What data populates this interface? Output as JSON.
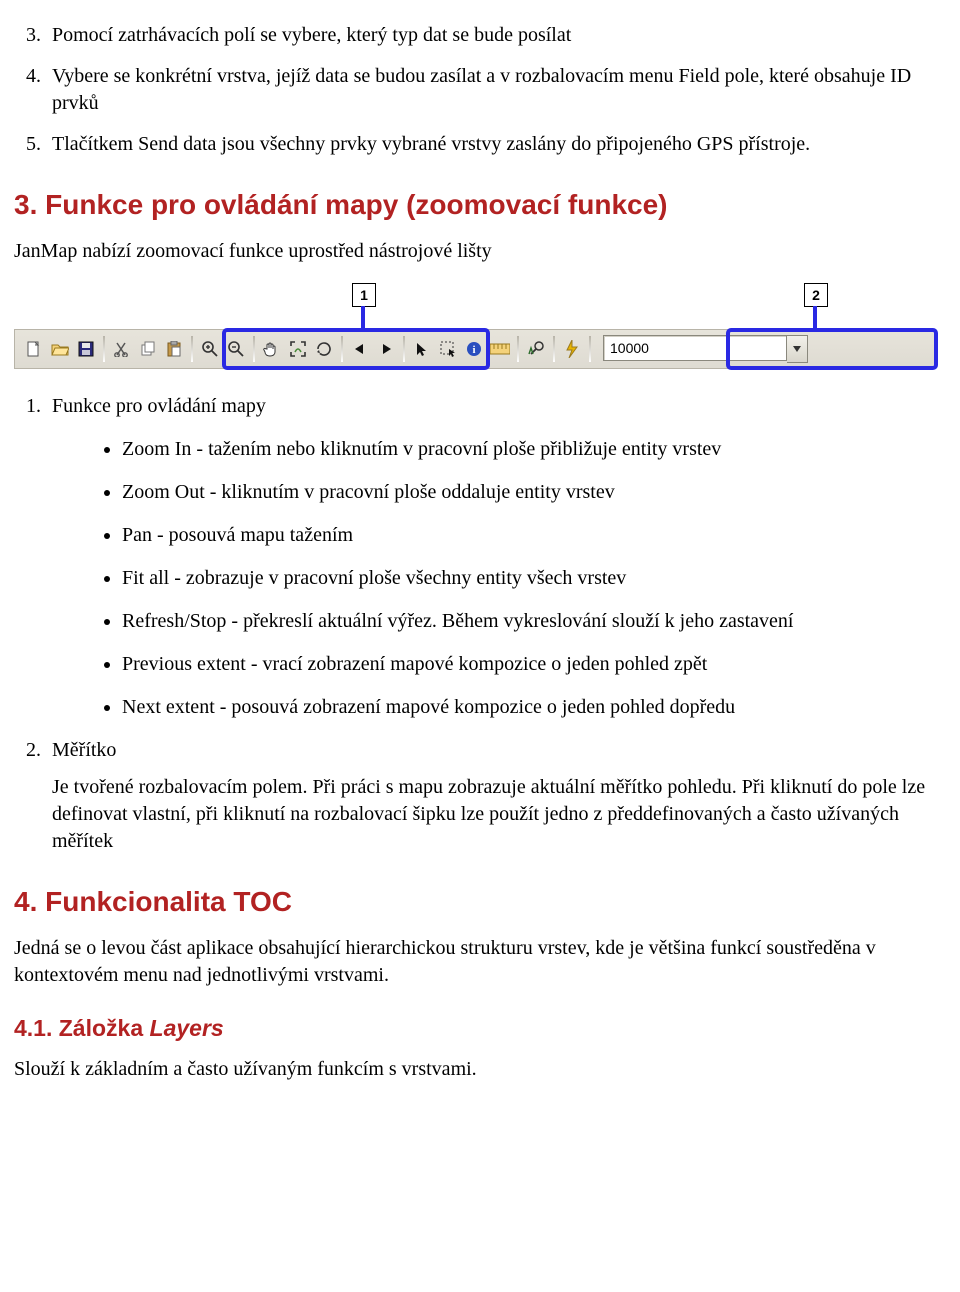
{
  "intro_list": {
    "start": 3,
    "items": [
      "Pomocí zatrhávacích polí se vybere, který typ dat se bude posílat",
      "Vybere se konkrétní vrstva, jejíž data se budou zasílat a v rozbalovacím menu Field pole, které obsahuje ID prvků",
      "Tlačítkem Send data jsou všechny prvky vybrané vrstvy zaslány do připojeného GPS přístroje."
    ]
  },
  "section3": {
    "title": "3. Funkce pro ovládání mapy (zoomovací funkce)",
    "intro": "JanMap nabízí zoomovací funkce uprostřed nástrojové lišty",
    "callouts": {
      "one": "1",
      "two": "2"
    },
    "toolbar": {
      "scale_value": "10000"
    },
    "list1_title": "Funkce pro ovládání mapy",
    "bullets": [
      "Zoom In - tažením nebo kliknutím v pracovní ploše přibližuje entity vrstev",
      "Zoom Out - kliknutím v pracovní ploše oddaluje entity vrstev",
      "Pan - posouvá mapu tažením",
      "Fit all - zobrazuje v pracovní ploše všechny entity všech vrstev",
      "Refresh/Stop - překreslí aktuální výřez. Během vykreslování slouží k jeho zastavení",
      "Previous extent - vrací zobrazení mapové kompozice o jeden pohled zpět",
      "Next extent - posouvá zobrazení mapové kompozice o jeden pohled dopředu"
    ],
    "list2_title": "Měřítko",
    "list2_para": "Je tvořené rozbalovacím polem. Při práci s mapu zobrazuje aktuální měřítko pohledu. Při kliknutí do pole lze definovat vlastní, při kliknutí na rozbalovací šipku lze použít jedno z předdefinovaných a často užívaných měřítek"
  },
  "section4": {
    "title": "4. Funkcionalita TOC",
    "intro": "Jedná se o levou část aplikace obsahující hierarchickou strukturu vrstev, kde je většina funkcí soustředěna v kontextovém menu nad jednotlivými vrstvami.",
    "sub41_title_plain": "4.1. Záložka ",
    "sub41_title_em": "Layers",
    "sub41_para": "Slouží k základním a často užívaným funkcím s vrstvami."
  }
}
